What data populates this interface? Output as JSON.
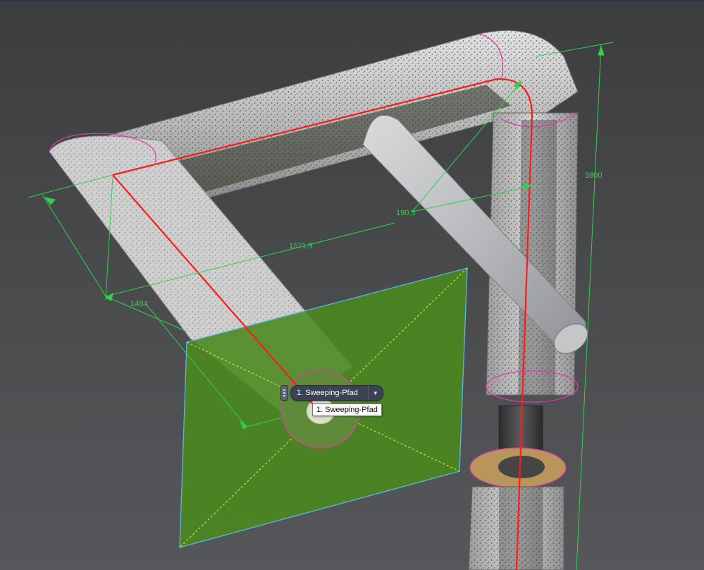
{
  "viewport": {
    "background_color": "#4a4a4a"
  },
  "dimensions": {
    "d1": "3800",
    "d2": "190,5",
    "d3": "1571,9",
    "d4": "1484"
  },
  "selector": {
    "dropdown_label": "1. Sweeping-Pfad",
    "arrow_icon": "chevron-down-icon",
    "tooltip": "1. Sweeping-Pfad"
  },
  "colors": {
    "dimension_lines": "#2fd24a",
    "sweep_path": "#ff1a1a",
    "profile_plane": "#4a8a1e",
    "profile_plane_edge": "#5ab4e6",
    "edge_highlight": "#e23aa9",
    "pipe_surface": "#cfcfcf"
  }
}
